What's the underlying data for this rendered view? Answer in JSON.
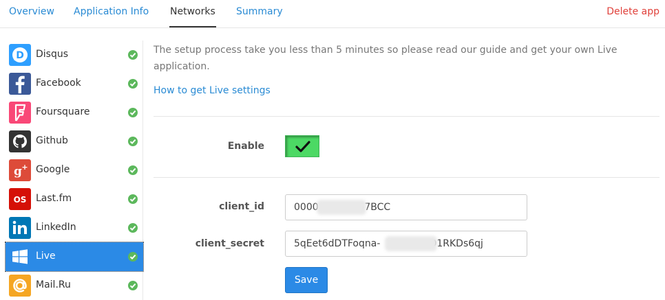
{
  "tabs": {
    "items": [
      {
        "label": "Overview",
        "active": false
      },
      {
        "label": "Application Info",
        "active": false
      },
      {
        "label": "Networks",
        "active": true
      },
      {
        "label": "Summary",
        "active": false
      }
    ],
    "delete_label": "Delete app"
  },
  "sidebar": {
    "items": [
      {
        "label": "Disqus",
        "icon": "disqus-icon",
        "color": "#2e9fff",
        "status": "check-icon",
        "active": false
      },
      {
        "label": "Facebook",
        "icon": "facebook-icon",
        "color": "#3b5998",
        "status": "check-icon",
        "active": false
      },
      {
        "label": "Foursquare",
        "icon": "foursquare-icon",
        "color": "#f94877",
        "status": "check-icon",
        "active": false
      },
      {
        "label": "Github",
        "icon": "github-icon",
        "color": "#333333",
        "status": "check-icon",
        "active": false
      },
      {
        "label": "Google",
        "icon": "google-plus-icon",
        "color": "#dd4b39",
        "status": "check-icon",
        "active": false
      },
      {
        "label": "Last.fm",
        "icon": "lastfm-icon",
        "color": "#d51007",
        "status": "check-icon",
        "active": false
      },
      {
        "label": "LinkedIn",
        "icon": "linkedin-icon",
        "color": "#0077b5",
        "status": "check-icon",
        "active": false
      },
      {
        "label": "Live",
        "icon": "windows-icon",
        "color": "#2b8ae6",
        "status": "check-icon",
        "active": true
      },
      {
        "label": "Mail.Ru",
        "icon": "mailru-icon",
        "color": "#f5a623",
        "status": "check-icon",
        "active": false
      }
    ],
    "check_color": "#5cb85c"
  },
  "content": {
    "intro": "The setup process take you less than 5 minutes so please read our guide and get your own Live application.",
    "guide_link": "How to get Live settings",
    "enable_label": "Enable",
    "enable_value": true,
    "client_id_label": "client_id",
    "client_id_value": "0000           157BCC",
    "client_secret_label": "client_secret",
    "client_secret_value": "5qEet6dDTFoqna-                D1RKDs6qj",
    "save_label": "Save"
  },
  "colors": {
    "accent": "#2b8ae6",
    "link": "#2a8bd4",
    "danger": "#e0413b",
    "toggle_on": "#4cd964"
  }
}
